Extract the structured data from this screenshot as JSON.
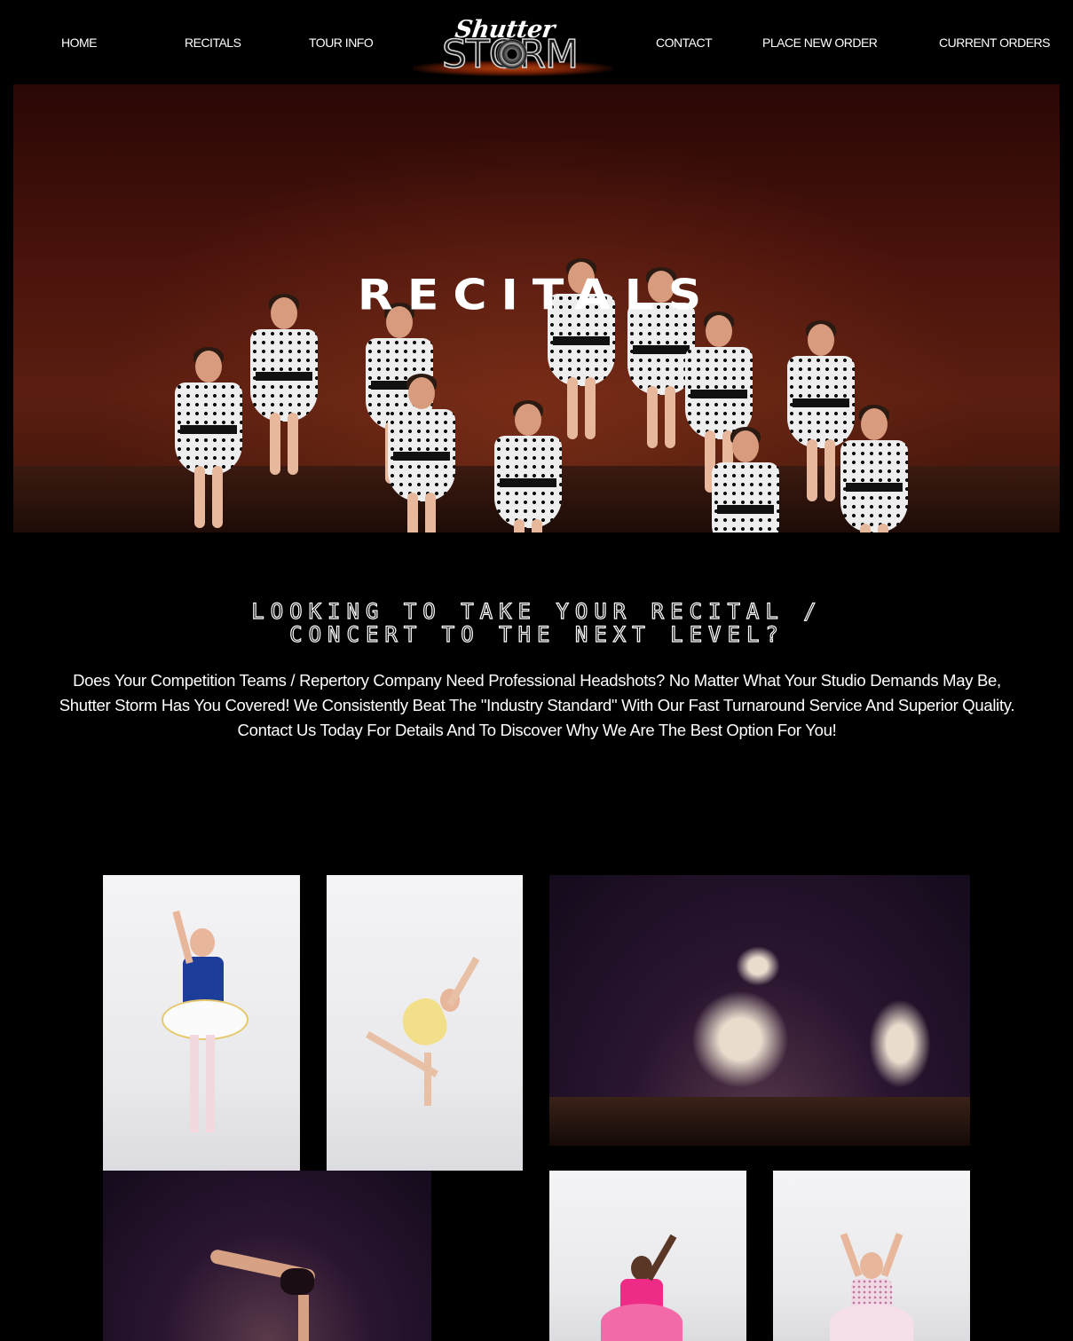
{
  "nav": {
    "left": [
      "HOME",
      "RECITALS",
      "TOUR INFO"
    ],
    "right": [
      "CONTACT",
      "PLACE NEW ORDER",
      "CURRENT ORDERS"
    ],
    "logo": {
      "script": "Shutter",
      "main": "STORM"
    }
  },
  "hero": {
    "title": "RECITALS"
  },
  "intro": {
    "heading_line1": "LOOKING TO TAKE YOUR RECITAL /",
    "heading_line2": "CONCERT TO THE NEXT LEVEL?",
    "body": "Does Your Competition Teams / Repertory Company Need Professional Headshots? No Matter What Your Studio Demands May Be, Shutter Storm Has You Covered! We Consistently Beat The \"Industry Standard\" With Our Fast Turnaround Service And Superior Quality. Contact Us Today For Details And To Discover Why We Are The Best Option For You!"
  },
  "colors": {
    "background": "#000000",
    "text": "#ffffff",
    "hero_tint": "#4a130c",
    "stage_purple": "#2a1530"
  }
}
